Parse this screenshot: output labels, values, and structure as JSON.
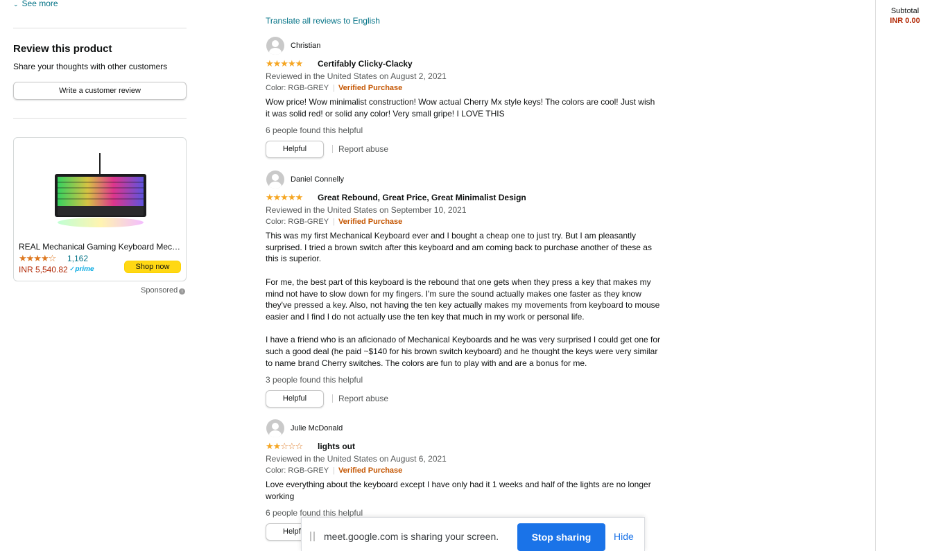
{
  "left": {
    "see_more": "See more",
    "review_title": "Review this product",
    "review_sub": "Share your thoughts with other customers",
    "write_review": "Write a customer review",
    "ad": {
      "name": "REAL Mechanical Gaming Keyboard Mechanical Swi...",
      "stars": "★★★★☆",
      "rating_count": "1,162",
      "price": "INR 5,540.82",
      "prime": "✓prime",
      "shop_now": "Shop now"
    },
    "sponsored": "Sponsored"
  },
  "reviews": {
    "translate": "Translate all reviews to English",
    "items": [
      {
        "name": "Christian",
        "stars": "★★★★★",
        "title": "Certifably Clicky-Clacky",
        "meta": "Reviewed in the United States on August 2, 2021",
        "color": "Color: RGB-GREY",
        "verified": "Verified Purchase",
        "body": [
          "Wow price! Wow minimalist construction! Wow actual Cherry Mx style keys! The colors are cool! Just wish it was solid red! or solid any color! Very small gripe! I LOVE THIS"
        ],
        "helpful_count": "6 people found this helpful",
        "helpful": "Helpful",
        "report": "Report abuse"
      },
      {
        "name": "Daniel Connelly",
        "stars": "★★★★★",
        "title": "Great Rebound, Great Price, Great Minimalist Design",
        "meta": "Reviewed in the United States on September 10, 2021",
        "color": "Color: RGB-GREY",
        "verified": "Verified Purchase",
        "body": [
          "This was my first Mechanical Keyboard ever and I bought a cheap one to just try. But I am pleasantly surprised. I tried a brown switch after this keyboard and am coming back to purchase another of these as this is superior.",
          "For me, the best part of this keyboard is the rebound that one gets when they press a key that makes my mind not have to slow down for my fingers. I'm sure the sound actually makes one faster as they know they've pressed a key. Also, not having the ten key actually makes my movements from keyboard to mouse easier and I find I do not actually use the ten key that much in my work or personal life.",
          "I have a friend who is an aficionado of Mechanical Keyboards and he was very surprised I could get one for such a good deal (he paid ~$140 for his brown switch keyboard) and he thought the keys were very similar to name brand Cherry switches. The colors are fun to play with and are a bonus for me."
        ],
        "helpful_count": "3 people found this helpful",
        "helpful": "Helpful",
        "report": "Report abuse"
      },
      {
        "name": "Julie McDonald",
        "stars": "★★",
        "stars_empty": "☆☆☆",
        "title": "lights out",
        "meta": "Reviewed in the United States on August 6, 2021",
        "color": "Color: RGB-GREY",
        "verified": "Verified Purchase",
        "body": [
          "Love everything about the keyboard except I have only had it 1 weeks and half of the lights are no longer working"
        ],
        "helpful_count": "6 people found this helpful",
        "helpful": "Helpf"
      }
    ]
  },
  "cart": {
    "subtotal_label": "Subtotal",
    "subtotal_value": "INR 0.00"
  },
  "share_bar": {
    "message": "meet.google.com is sharing your screen.",
    "stop": "Stop sharing",
    "hide": "Hide"
  }
}
